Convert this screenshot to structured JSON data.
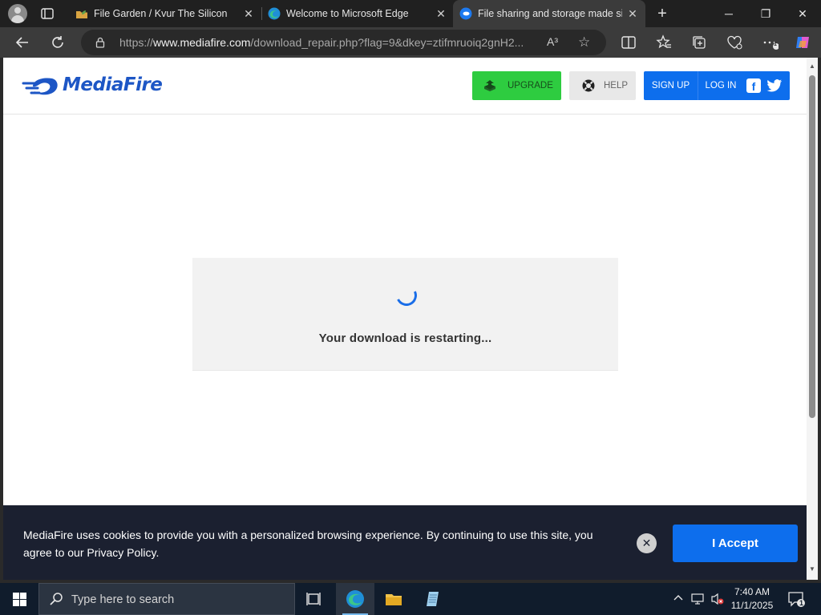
{
  "browser": {
    "tabs": [
      {
        "title": "File Garden / Kvur The Silicon",
        "active": false
      },
      {
        "title": "Welcome to Microsoft Edge",
        "active": false
      },
      {
        "title": "File sharing and storage made sim",
        "active": true
      }
    ],
    "new_tab_label": "+",
    "window_controls": {
      "minimize": "─",
      "maximize": "❐",
      "close": "✕"
    },
    "url_prefix": "https://",
    "url_domain": "www.mediafire.com",
    "url_path": "/download_repair.php?flag=9&dkey=ztifmruoiq2gnH2...",
    "read_aloud_label": "A³",
    "favorite_glyph": "☆",
    "extensions_badge": "1"
  },
  "site": {
    "logo_text": "MediaFire",
    "brand_color": "#1d56c5",
    "nav": {
      "upgrade": "UPGRADE",
      "help": "HELP",
      "sign_up": "SIGN UP",
      "log_in": "LOG IN",
      "facebook_glyph": "f"
    }
  },
  "main": {
    "status_message": "Your download is restarting..."
  },
  "cookie_banner": {
    "text": "MediaFire uses cookies to provide you with a personalized browsing experience. By continuing to use this site, you agree to our Privacy Policy.",
    "close_glyph": "✕",
    "accept_label": "I Accept"
  },
  "taskbar": {
    "search_placeholder": "Type here to search",
    "time": "7:40 AM",
    "date": "11/1/2025",
    "notification_count": "1"
  }
}
